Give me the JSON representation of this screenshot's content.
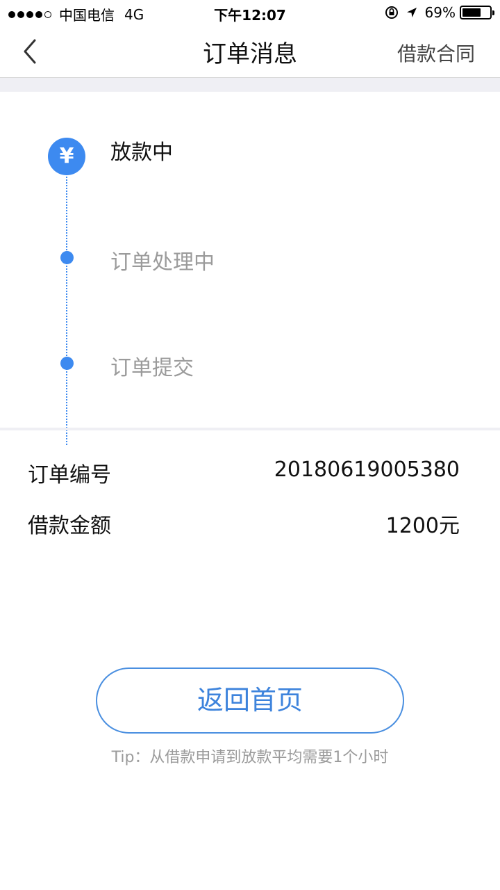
{
  "status_bar": {
    "carrier": "中国电信",
    "network": "4G",
    "time": "下午12:07",
    "battery": "69%",
    "battery_level": 0.69
  },
  "nav": {
    "title": "订单消息",
    "action": "借款合同",
    "back_icon": "chevron-left-icon"
  },
  "timeline": {
    "current_icon_symbol": "¥",
    "steps": [
      {
        "label": "放款中",
        "state": "active"
      },
      {
        "label": "订单处理中",
        "state": "done"
      },
      {
        "label": "订单提交",
        "state": "done"
      }
    ],
    "accent_color": "#3d8af0"
  },
  "order": {
    "number_label": "订单编号",
    "number_value": "20180619005380",
    "amount_label": "借款金额",
    "amount_value": "1200元"
  },
  "home_button": {
    "label": "返回首页"
  },
  "tip": "Tip：从借款申请到放款平均需要1个小时"
}
